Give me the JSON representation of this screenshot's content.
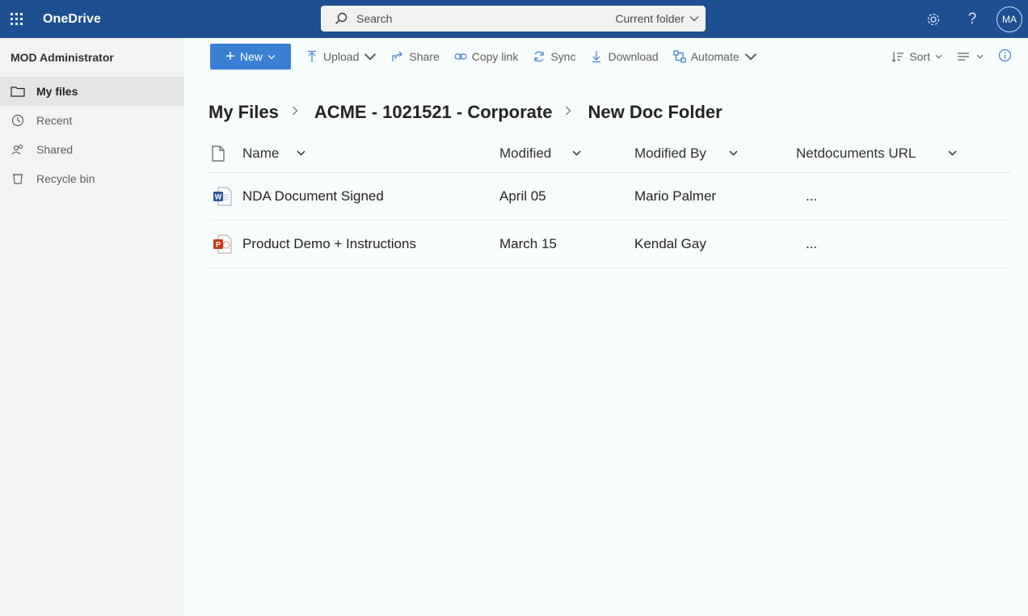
{
  "suite": {
    "app_name": "OneDrive",
    "search_placeholder": "Search",
    "search_scope": "Current folder",
    "avatar_initials": "MA"
  },
  "nav": {
    "user": "MOD Administrator",
    "items": [
      {
        "label": "My files",
        "icon": "folder-icon",
        "active": true
      },
      {
        "label": "Recent",
        "icon": "history-icon"
      },
      {
        "label": "Shared",
        "icon": "people-icon"
      },
      {
        "label": "Recycle bin",
        "icon": "recycle-bin-icon"
      }
    ]
  },
  "toolbar": {
    "new_label": "New",
    "upload_label": "Upload",
    "share_label": "Share",
    "copy_link_label": "Copy link",
    "sync_label": "Sync",
    "download_label": "Download",
    "automate_label": "Automate",
    "sort_label": "Sort"
  },
  "breadcrumb": [
    "My Files",
    "ACME - 1021521 - Corporate",
    "New Doc Folder"
  ],
  "table": {
    "columns": [
      "Name",
      "Modified",
      "Modified By",
      "Netdocuments URL"
    ],
    "rows": [
      {
        "name": "NDA Document Signed",
        "modified": "April 05",
        "modified_by": "Mario Palmer",
        "url": "...",
        "type": "word"
      },
      {
        "name": "Product Demo + Instructions",
        "modified": "March 15",
        "modified_by": "Kendal Gay",
        "url": "...",
        "type": "powerpoint"
      }
    ]
  },
  "colors": {
    "suite_bar": "#1d4f91",
    "new_button": "#3b7fd3",
    "word": "#2b579a",
    "powerpoint": "#c43e1c"
  }
}
